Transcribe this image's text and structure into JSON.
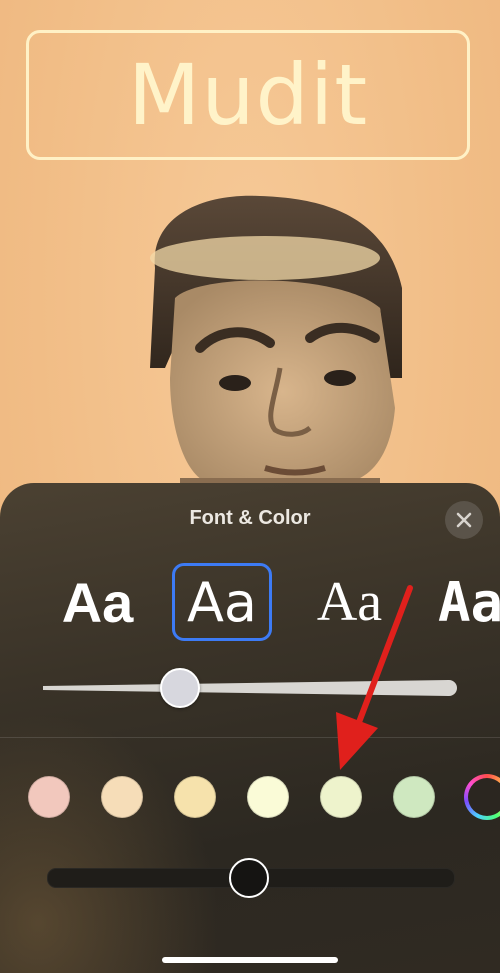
{
  "poster": {
    "name": "Mudit",
    "accent_color": "#fff1c6",
    "background_color": "#f3c28e"
  },
  "sheet": {
    "title": "Font & Color",
    "close_icon": "close-icon"
  },
  "fonts": [
    {
      "label": "Aa",
      "style": "bold-sans",
      "selected": false
    },
    {
      "label": "Aa",
      "style": "regular-sans",
      "selected": true
    },
    {
      "label": "Aa",
      "style": "serif",
      "selected": false
    },
    {
      "label": "Aa",
      "style": "condensed-mono",
      "selected": false
    }
  ],
  "font_weight_slider": {
    "value": 0.33
  },
  "colors": [
    {
      "name": "pink",
      "hex": "#f2c8bd"
    },
    {
      "name": "peach",
      "hex": "#f6ddb8"
    },
    {
      "name": "light-yellow",
      "hex": "#f6e2ac"
    },
    {
      "name": "cream",
      "hex": "#fafbd7"
    },
    {
      "name": "pale-green",
      "hex": "#eef3cc"
    },
    {
      "name": "mint",
      "hex": "#cfe8c0"
    },
    {
      "name": "custom-color",
      "hex": "rainbow"
    }
  ],
  "shade_slider": {
    "value": 0.5
  },
  "selection_color": "#3d7bf5",
  "annotation_color": "#e0201c"
}
